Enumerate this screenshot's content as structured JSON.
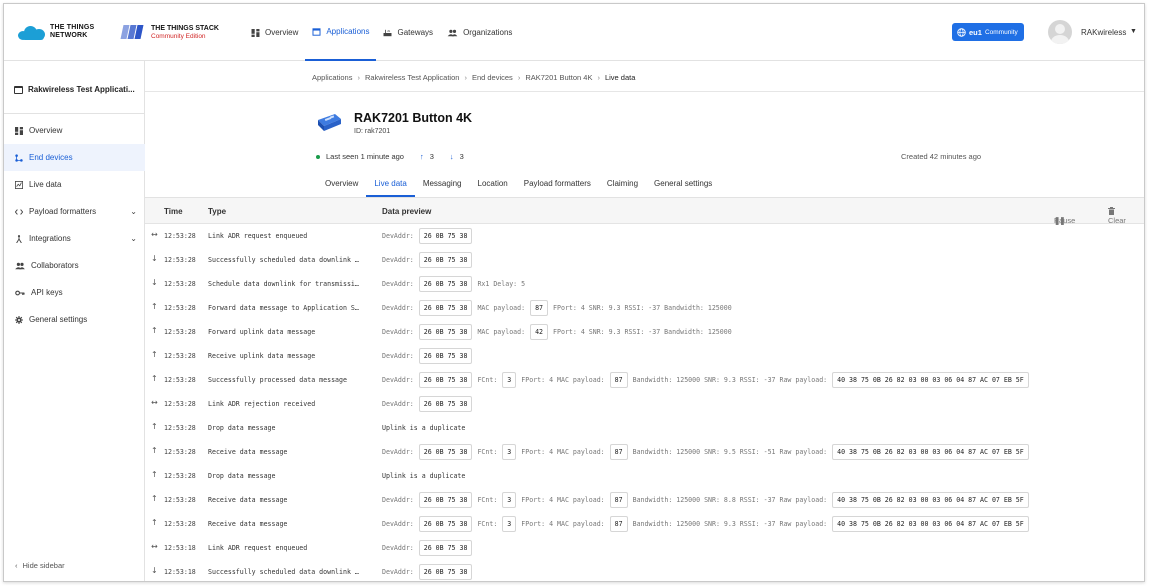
{
  "header": {
    "ttn_logo": "THE THINGS NETWORK",
    "ttn_logo_line1": "THE THINGS",
    "ttn_logo_line2": "NETWORK",
    "stack_logo_line1": "THE THINGS STACK",
    "stack_logo_line2": "Community Edition",
    "nav": [
      {
        "label": "Overview",
        "icon": "grid-icon"
      },
      {
        "label": "Applications",
        "icon": "window-icon",
        "active": true
      },
      {
        "label": "Gateways",
        "icon": "gateway-icon"
      },
      {
        "label": "Organizations",
        "icon": "people-icon"
      }
    ],
    "cluster": {
      "region": "eu1",
      "label": "Community"
    },
    "user": "RAKwireless"
  },
  "sidebar": {
    "app_title": "Rakwireless Test Applicati...",
    "items": [
      {
        "label": "Overview",
        "icon": "grid-icon"
      },
      {
        "label": "End devices",
        "icon": "devices-icon",
        "active": true
      },
      {
        "label": "Live data",
        "icon": "live-data-icon"
      },
      {
        "label": "Payload formatters",
        "icon": "code-icon",
        "expandable": true
      },
      {
        "label": "Integrations",
        "icon": "integrations-icon",
        "expandable": true
      },
      {
        "label": "Collaborators",
        "icon": "people-icon"
      },
      {
        "label": "API keys",
        "icon": "key-icon"
      },
      {
        "label": "General settings",
        "icon": "gear-icon"
      }
    ],
    "hide_label": "Hide sidebar"
  },
  "breadcrumb": [
    "Applications",
    "Rakwireless Test Application",
    "End devices",
    "RAK7201 Button 4K",
    "Live data"
  ],
  "device": {
    "name": "RAK7201 Button 4K",
    "id": "ID: rak7201",
    "last_seen": "Last seen 1 minute ago",
    "uplinks": "3",
    "downlinks": "3",
    "created": "Created 42 minutes ago"
  },
  "tabs": [
    "Overview",
    "Live data",
    "Messaging",
    "Location",
    "Payload formatters",
    "Claiming",
    "General settings"
  ],
  "active_tab": "Live data",
  "table": {
    "headers": {
      "time": "Time",
      "type": "Type",
      "preview": "Data preview"
    },
    "pause": "Pause",
    "clear": "Clear",
    "rows": [
      {
        "dir": "both",
        "time": "12:53:28",
        "type": "Link ADR request enqueued",
        "preview": [
          {
            "l": "DevAddr:"
          },
          {
            "b": "26 0B 75 38"
          }
        ]
      },
      {
        "dir": "down",
        "time": "12:53:28",
        "type": "Successfully scheduled data downlink …",
        "preview": [
          {
            "l": "DevAddr:"
          },
          {
            "b": "26 0B 75 38"
          }
        ]
      },
      {
        "dir": "down",
        "time": "12:53:28",
        "type": "Schedule data downlink for transmissi…",
        "preview": [
          {
            "l": "DevAddr:"
          },
          {
            "b": "26 0B 75 38"
          },
          {
            "l": "Rx1 Delay: 5"
          }
        ]
      },
      {
        "dir": "up",
        "time": "12:53:28",
        "type": "Forward data message to Application S…",
        "preview": [
          {
            "l": "DevAddr:"
          },
          {
            "b": "26 0B 75 38"
          },
          {
            "l": "MAC payload:"
          },
          {
            "b": "87"
          },
          {
            "l": "FPort: 4  SNR: 9.3  RSSI: -37  Bandwidth: 125000"
          }
        ]
      },
      {
        "dir": "up",
        "time": "12:53:28",
        "type": "Forward uplink data message",
        "preview": [
          {
            "l": "DevAddr:"
          },
          {
            "b": "26 0B 75 38"
          },
          {
            "l": "MAC payload:"
          },
          {
            "b": "42"
          },
          {
            "l": "FPort: 4  SNR: 9.3  RSSI: -37  Bandwidth: 125000"
          }
        ]
      },
      {
        "dir": "up",
        "time": "12:53:28",
        "type": "Receive uplink data message",
        "preview": [
          {
            "l": "DevAddr:"
          },
          {
            "b": "26 0B 75 38"
          }
        ]
      },
      {
        "dir": "up",
        "time": "12:53:28",
        "type": "Successfully processed data message",
        "preview": [
          {
            "l": "DevAddr:"
          },
          {
            "b": "26 0B 75 38"
          },
          {
            "l": "FCnt:"
          },
          {
            "b": "3"
          },
          {
            "l": "FPort: 4  MAC payload:"
          },
          {
            "b": "87"
          },
          {
            "l": "Bandwidth: 125000  SNR: 9.3  RSSI: -37  Raw payload:"
          },
          {
            "b": "40 38 75 0B 26 82 03 00 03 06 04 87 AC 07 EB 5F"
          }
        ]
      },
      {
        "dir": "both",
        "time": "12:53:28",
        "type": "Link ADR rejection received",
        "preview": [
          {
            "l": "DevAddr:"
          },
          {
            "b": "26 0B 75 38"
          }
        ]
      },
      {
        "dir": "up",
        "time": "12:53:28",
        "type": "Drop data message",
        "preview": [
          {
            "p": "Uplink is a duplicate"
          }
        ]
      },
      {
        "dir": "up",
        "time": "12:53:28",
        "type": "Receive data message",
        "preview": [
          {
            "l": "DevAddr:"
          },
          {
            "b": "26 0B 75 38"
          },
          {
            "l": "FCnt:"
          },
          {
            "b": "3"
          },
          {
            "l": "FPort: 4  MAC payload:"
          },
          {
            "b": "87"
          },
          {
            "l": "Bandwidth: 125000  SNR: 9.5  RSSI: -51  Raw payload:"
          },
          {
            "b": "40 38 75 0B 26 82 03 00 03 06 04 87 AC 07 EB 5F"
          }
        ]
      },
      {
        "dir": "up",
        "time": "12:53:28",
        "type": "Drop data message",
        "preview": [
          {
            "p": "Uplink is a duplicate"
          }
        ]
      },
      {
        "dir": "up",
        "time": "12:53:28",
        "type": "Receive data message",
        "preview": [
          {
            "l": "DevAddr:"
          },
          {
            "b": "26 0B 75 38"
          },
          {
            "l": "FCnt:"
          },
          {
            "b": "3"
          },
          {
            "l": "FPort: 4  MAC payload:"
          },
          {
            "b": "87"
          },
          {
            "l": "Bandwidth: 125000  SNR: 8.8  RSSI: -37  Raw payload:"
          },
          {
            "b": "40 38 75 0B 26 82 03 00 03 06 04 87 AC 07 EB 5F"
          }
        ]
      },
      {
        "dir": "up",
        "time": "12:53:28",
        "type": "Receive data message",
        "preview": [
          {
            "l": "DevAddr:"
          },
          {
            "b": "26 0B 75 38"
          },
          {
            "l": "FCnt:"
          },
          {
            "b": "3"
          },
          {
            "l": "FPort: 4  MAC payload:"
          },
          {
            "b": "87"
          },
          {
            "l": "Bandwidth: 125000  SNR: 9.3  RSSI: -37  Raw payload:"
          },
          {
            "b": "40 38 75 0B 26 82 03 00 03 06 04 87 AC 07 EB 5F"
          }
        ]
      },
      {
        "dir": "both",
        "time": "12:53:18",
        "type": "Link ADR request enqueued",
        "preview": [
          {
            "l": "DevAddr:"
          },
          {
            "b": "26 0B 75 38"
          }
        ]
      },
      {
        "dir": "down",
        "time": "12:53:18",
        "type": "Successfully scheduled data downlink …",
        "preview": [
          {
            "l": "DevAddr:"
          },
          {
            "b": "26 0B 75 38"
          }
        ]
      }
    ]
  },
  "colors": {
    "accent": "#1a5fd6",
    "brand_blue": "#1c9fd6",
    "stack_red": "#d12626",
    "online": "#1a9b4b"
  }
}
